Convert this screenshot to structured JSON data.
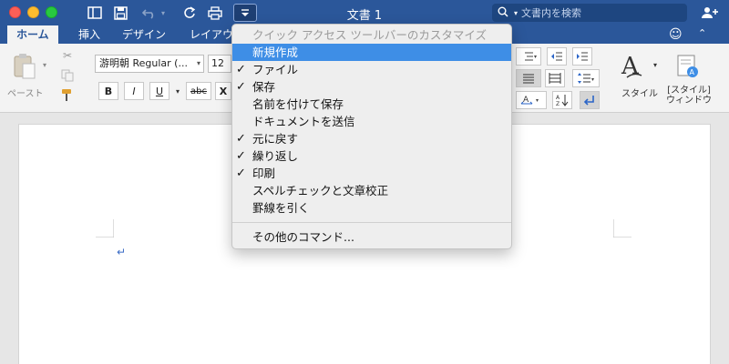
{
  "window": {
    "title": "文書 1",
    "search_placeholder": "文書内を検索"
  },
  "tabs": [
    {
      "label": "ホーム",
      "active": true
    },
    {
      "label": "挿入"
    },
    {
      "label": "デザイン"
    },
    {
      "label": "レイアウ"
    }
  ],
  "ribbon": {
    "paste_label": "ペースト",
    "font_name": "游明朝 Regular (...",
    "font_size": "12",
    "bold": "B",
    "italic": "I",
    "underline": "U",
    "strike": "abc",
    "subscript": "X",
    "styles_label": "スタイル",
    "styles_window_label_1": "[スタイル]",
    "styles_window_label_2": "ウィンドウ"
  },
  "menu": {
    "header": "クイック アクセス ツールバーのカスタマイズ",
    "items": [
      {
        "label": "新規作成",
        "checked": false,
        "highlighted": true
      },
      {
        "label": "ファイル",
        "checked": true
      },
      {
        "label": "保存",
        "checked": true
      },
      {
        "label": "名前を付けて保存",
        "checked": false
      },
      {
        "label": "ドキュメントを送信",
        "checked": false
      },
      {
        "label": "元に戻す",
        "checked": true
      },
      {
        "label": "繰り返し",
        "checked": true
      },
      {
        "label": "印刷",
        "checked": true
      },
      {
        "label": "スペルチェックと文章校正",
        "checked": false
      },
      {
        "label": "罫線を引く",
        "checked": false
      }
    ],
    "more_commands": "その他のコマンド..."
  },
  "document": {
    "paragraph_mark": "↵"
  },
  "colors": {
    "title_bar": "#2b579a",
    "menu_highlight": "#3e8ee6"
  }
}
